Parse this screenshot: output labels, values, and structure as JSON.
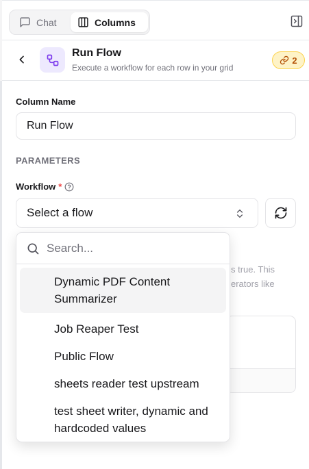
{
  "tabs": {
    "chat": "Chat",
    "columns": "Columns"
  },
  "header": {
    "title": "Run Flow",
    "subtitle": "Execute a workflow for each row in your grid",
    "badge_count": "2"
  },
  "form": {
    "column_name_label": "Column Name",
    "column_name_value": "Run Flow",
    "parameters_heading": "PARAMETERS",
    "workflow_label": "Workflow",
    "required_mark": "*",
    "workflow_select_value": "Select a flow"
  },
  "dropdown": {
    "search_placeholder": "Search...",
    "options": [
      {
        "label": "Dynamic PDF Content Summarizer"
      },
      {
        "label": "Job Reaper Test"
      },
      {
        "label": "Public Flow"
      },
      {
        "label": "sheets reader test upstream"
      },
      {
        "label": "test sheet writer, dynamic and hardcoded values"
      }
    ]
  },
  "background_text": {
    "line1": "s true. This",
    "line2": "erators like"
  },
  "colors": {
    "accent_purple": "#7c3aed",
    "badge_amber": "#b45309",
    "required_red": "#ef4444"
  }
}
